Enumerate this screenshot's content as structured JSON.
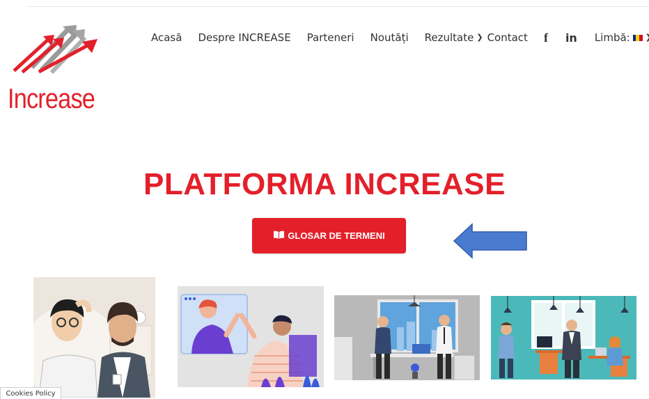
{
  "brand": {
    "name": "Increase",
    "colors": {
      "primary": "#e3202a",
      "gray": "#8c8c8c",
      "arrow_blue": "#4a7bd0"
    }
  },
  "nav": {
    "items": [
      {
        "label": "Acasă"
      },
      {
        "label": "Despre INCREASE"
      },
      {
        "label": "Parteneri"
      },
      {
        "label": "Noutăți"
      },
      {
        "label": "Rezultate",
        "has_dropdown": true
      },
      {
        "label": "Contact"
      }
    ],
    "social": [
      {
        "icon": "facebook-icon",
        "label": "f"
      },
      {
        "icon": "linkedin-icon",
        "label": "in"
      }
    ],
    "language": {
      "label": "Limbă:",
      "flag": "romania-flag-icon"
    }
  },
  "hero": {
    "title": "PLATFORMA INCREASE",
    "button_label": "GLOSAR DE TERMENI",
    "button_icon": "book-icon"
  },
  "images": [
    {
      "icon": "confused-people-illustration"
    },
    {
      "icon": "high-five-video-call-illustration"
    },
    {
      "icon": "office-meeting-illustration"
    },
    {
      "icon": "office-team-illustration"
    }
  ],
  "footer": {
    "cookies_label": "Cookies Policy"
  }
}
